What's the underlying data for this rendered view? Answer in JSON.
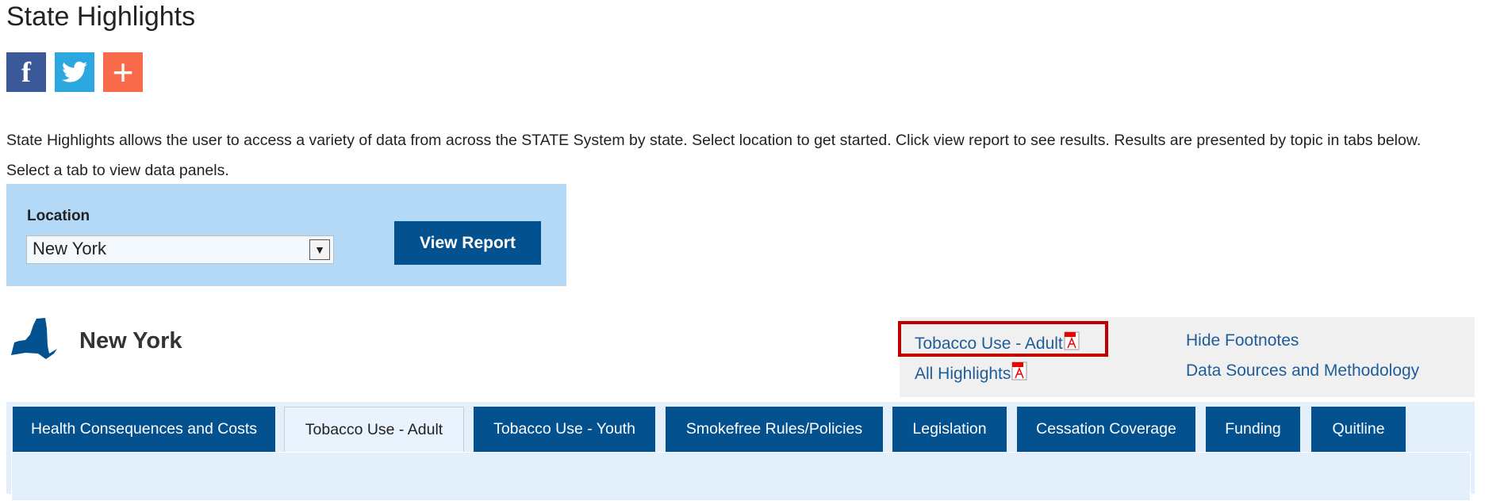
{
  "page": {
    "title": "State Highlights",
    "intro": "State Highlights allows the user to access a variety of data from across the STATE System by state. Select location to get started. Click view report to see results. Results are presented by topic in tabs below. Select a tab to view data panels."
  },
  "social": [
    {
      "icon": "facebook-icon",
      "glyph": "f",
      "color": "#3b5998"
    },
    {
      "icon": "twitter-icon",
      "glyph": "t",
      "color": "#2ca7e0"
    },
    {
      "icon": "add-share-icon",
      "glyph": "+",
      "color": "#f96a4b"
    }
  ],
  "location": {
    "label": "Location",
    "selected": "New York",
    "button": "View Report"
  },
  "state": {
    "name": "New York",
    "icon": "new-york-state-map-icon",
    "color": "#04518f"
  },
  "links": {
    "tobacco_adult": "Tobacco Use - Adult",
    "all_highlights": "All Highlights",
    "hide_footnotes": "Hide Footnotes",
    "data_sources": "Data Sources and Methodology"
  },
  "tabs": [
    {
      "label": "Health Consequences and Costs"
    },
    {
      "label": "Tobacco Use - Adult",
      "active": true
    },
    {
      "label": "Tobacco Use - Youth"
    },
    {
      "label": "Smokefree Rules/Policies"
    },
    {
      "label": "Legislation"
    },
    {
      "label": "Cessation Coverage"
    },
    {
      "label": "Funding"
    },
    {
      "label": "Quitline"
    }
  ],
  "colors": {
    "accent": "#04518f",
    "highlight": "#c00000",
    "location_bg": "#b3d9f7"
  }
}
